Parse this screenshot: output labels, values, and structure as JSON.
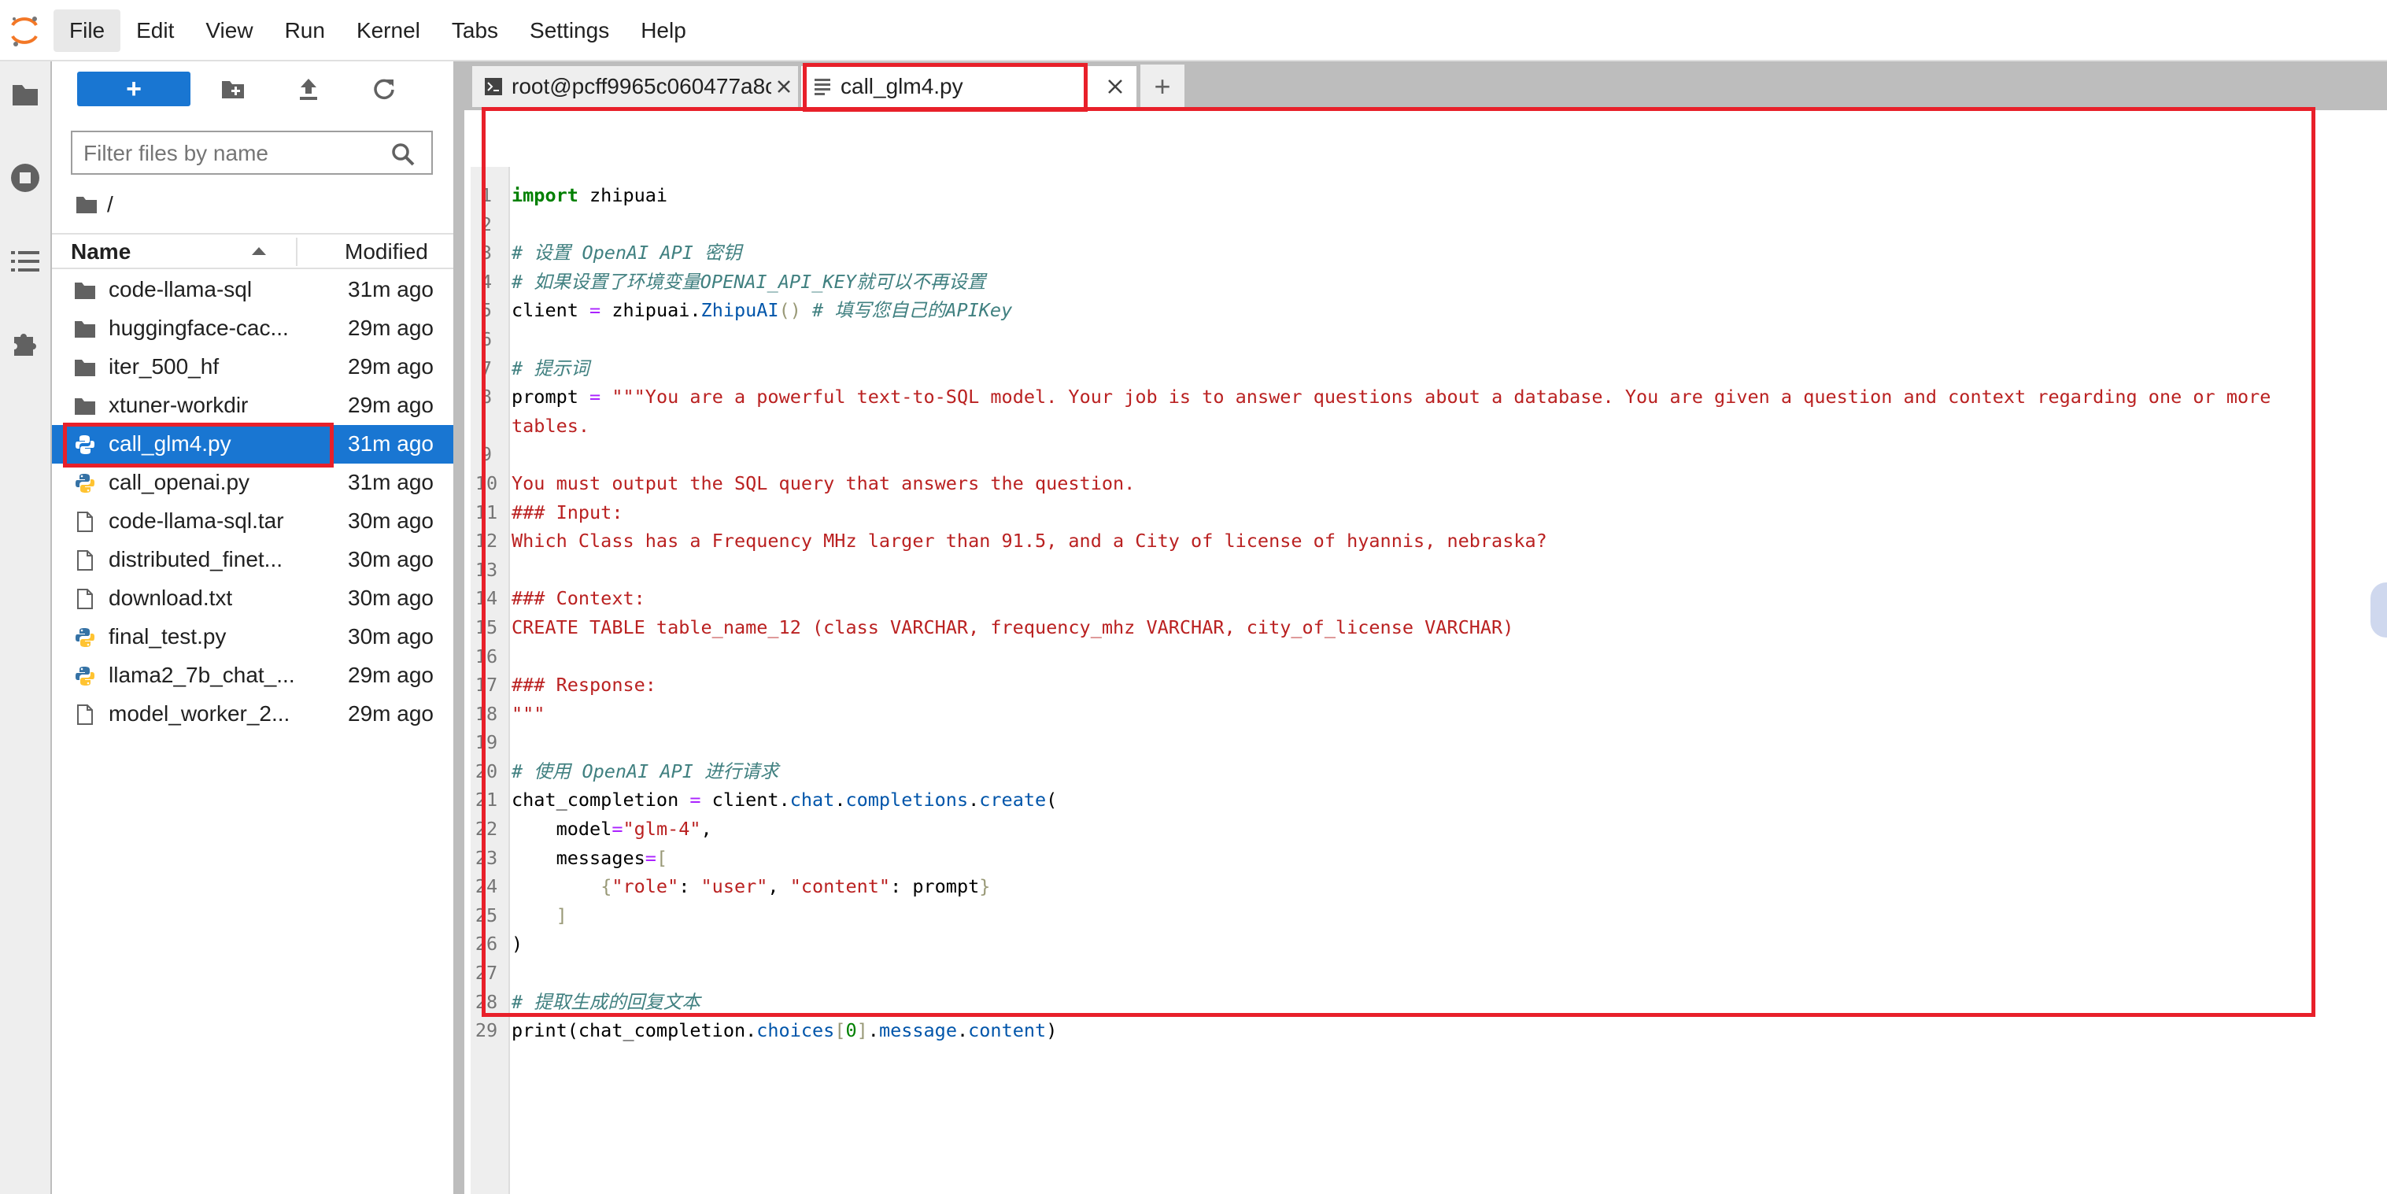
{
  "menubar": {
    "items": [
      {
        "label": "File",
        "active": true
      },
      {
        "label": "Edit"
      },
      {
        "label": "View"
      },
      {
        "label": "Run"
      },
      {
        "label": "Kernel"
      },
      {
        "label": "Tabs"
      },
      {
        "label": "Settings"
      },
      {
        "label": "Help"
      }
    ]
  },
  "activity_bar": {
    "icons": [
      "folder-icon",
      "running-stop-icon",
      "table-of-contents-icon",
      "extension-puzzle-icon"
    ]
  },
  "file_browser": {
    "new_button_label": "+",
    "filter_placeholder": "Filter files by name",
    "breadcrumb": "/",
    "columns": {
      "name": "Name",
      "modified": "Modified"
    },
    "files": [
      {
        "name": "code-llama-sql",
        "modified": "31m ago",
        "type": "folder"
      },
      {
        "name": "huggingface-cac...",
        "modified": "29m ago",
        "type": "folder"
      },
      {
        "name": "iter_500_hf",
        "modified": "29m ago",
        "type": "folder"
      },
      {
        "name": "xtuner-workdir",
        "modified": "29m ago",
        "type": "folder"
      },
      {
        "name": "call_glm4.py",
        "modified": "31m ago",
        "type": "python",
        "selected": true
      },
      {
        "name": "call_openai.py",
        "modified": "31m ago",
        "type": "python"
      },
      {
        "name": "code-llama-sql.tar",
        "modified": "30m ago",
        "type": "file"
      },
      {
        "name": "distributed_finet...",
        "modified": "30m ago",
        "type": "file"
      },
      {
        "name": "download.txt",
        "modified": "30m ago",
        "type": "file"
      },
      {
        "name": "final_test.py",
        "modified": "30m ago",
        "type": "python"
      },
      {
        "name": "llama2_7b_chat_...",
        "modified": "29m ago",
        "type": "python"
      },
      {
        "name": "model_worker_2...",
        "modified": "29m ago",
        "type": "file"
      }
    ]
  },
  "tabs": [
    {
      "label": "root@pcff9965c060477a8c",
      "kind": "terminal"
    },
    {
      "label": "call_glm4.py",
      "kind": "editor",
      "current": true
    }
  ],
  "tab_add_label": "+",
  "editor": {
    "lines": [
      {
        "n": "1",
        "parts": [
          [
            "kw",
            "import"
          ],
          [
            "",
            " zhipuai"
          ]
        ]
      },
      {
        "n": "2",
        "parts": []
      },
      {
        "n": "3",
        "parts": [
          [
            "cm",
            "# 设置 OpenAI API 密钥"
          ]
        ]
      },
      {
        "n": "4",
        "parts": [
          [
            "cm",
            "# 如果设置了环境变量OPENAI_API_KEY就可以不再设置"
          ]
        ]
      },
      {
        "n": "5",
        "parts": [
          [
            "",
            "client "
          ],
          [
            "op",
            "="
          ],
          [
            "",
            " zhipuai."
          ],
          [
            "at",
            "ZhipuAI"
          ],
          [
            "br",
            "()"
          ],
          [
            "",
            " "
          ],
          [
            "cm",
            "# 填写您自己的APIKey"
          ]
        ]
      },
      {
        "n": "6",
        "parts": []
      },
      {
        "n": "7",
        "parts": [
          [
            "cm",
            "# 提示词"
          ]
        ]
      },
      {
        "n": "8",
        "parts": [
          [
            "",
            "prompt "
          ],
          [
            "op",
            "="
          ],
          [
            "",
            " "
          ],
          [
            "st",
            "\"\"\"You are a powerful text-to-SQL model. Your job is to answer questions about a database. You are given a question and context regarding one or more"
          ]
        ]
      },
      {
        "n": "",
        "parts": [
          [
            "st",
            "tables."
          ]
        ]
      },
      {
        "n": "9",
        "parts": []
      },
      {
        "n": "10",
        "parts": [
          [
            "st",
            "You must output the SQL query that answers the question."
          ]
        ]
      },
      {
        "n": "11",
        "parts": [
          [
            "st",
            "### Input:"
          ]
        ]
      },
      {
        "n": "12",
        "parts": [
          [
            "st",
            "Which Class has a Frequency MHz larger than 91.5, and a City of license of hyannis, nebraska?"
          ]
        ]
      },
      {
        "n": "13",
        "parts": []
      },
      {
        "n": "14",
        "parts": [
          [
            "st",
            "### Context:"
          ]
        ]
      },
      {
        "n": "15",
        "parts": [
          [
            "st",
            "CREATE TABLE table_name_12 (class VARCHAR, frequency_mhz VARCHAR, city_of_license VARCHAR)"
          ]
        ]
      },
      {
        "n": "16",
        "parts": []
      },
      {
        "n": "17",
        "parts": [
          [
            "st",
            "### Response:"
          ]
        ]
      },
      {
        "n": "18",
        "parts": [
          [
            "st",
            "\"\"\""
          ]
        ]
      },
      {
        "n": "19",
        "parts": []
      },
      {
        "n": "20",
        "parts": [
          [
            "cm",
            "# 使用 OpenAI API 进行请求"
          ]
        ]
      },
      {
        "n": "21",
        "parts": [
          [
            "",
            "chat_completion "
          ],
          [
            "op",
            "="
          ],
          [
            "",
            " client."
          ],
          [
            "at",
            "chat"
          ],
          [
            "",
            "."
          ],
          [
            "at",
            "completions"
          ],
          [
            "",
            "."
          ],
          [
            "at",
            "create"
          ],
          [
            "",
            "("
          ]
        ]
      },
      {
        "n": "22",
        "parts": [
          [
            "",
            "    model"
          ],
          [
            "op",
            "="
          ],
          [
            "st",
            "\"glm-4\""
          ],
          [
            "",
            ","
          ]
        ]
      },
      {
        "n": "23",
        "parts": [
          [
            "",
            "    messages"
          ],
          [
            "op",
            "="
          ],
          [
            "br",
            "["
          ]
        ]
      },
      {
        "n": "24",
        "parts": [
          [
            "",
            "        "
          ],
          [
            "br",
            "{"
          ],
          [
            "st",
            "\"role\""
          ],
          [
            "",
            ": "
          ],
          [
            "st",
            "\"user\""
          ],
          [
            "",
            ", "
          ],
          [
            "st",
            "\"content\""
          ],
          [
            "",
            ": prompt"
          ],
          [
            "br",
            "}"
          ]
        ]
      },
      {
        "n": "25",
        "parts": [
          [
            "",
            "    "
          ],
          [
            "br",
            "]"
          ]
        ]
      },
      {
        "n": "26",
        "parts": [
          [
            "",
            ")"
          ]
        ]
      },
      {
        "n": "27",
        "parts": []
      },
      {
        "n": "28",
        "parts": [
          [
            "cm",
            "# 提取生成的回复文本"
          ]
        ]
      },
      {
        "n": "29",
        "parts": [
          [
            "",
            "print(chat_completion."
          ],
          [
            "at",
            "choices"
          ],
          [
            "br",
            "["
          ],
          [
            "nm",
            "0"
          ],
          [
            "br",
            "]"
          ],
          [
            "",
            "."
          ],
          [
            "at",
            "message"
          ],
          [
            "",
            "."
          ],
          [
            "at",
            "content"
          ],
          [
            "",
            ")"
          ]
        ]
      }
    ]
  },
  "colors": {
    "accent": "#1976d2",
    "highlight_box": "#e8202a",
    "keyword": "#008000",
    "comment": "#408080",
    "string": "#ba2121",
    "operator": "#aa22ff"
  }
}
